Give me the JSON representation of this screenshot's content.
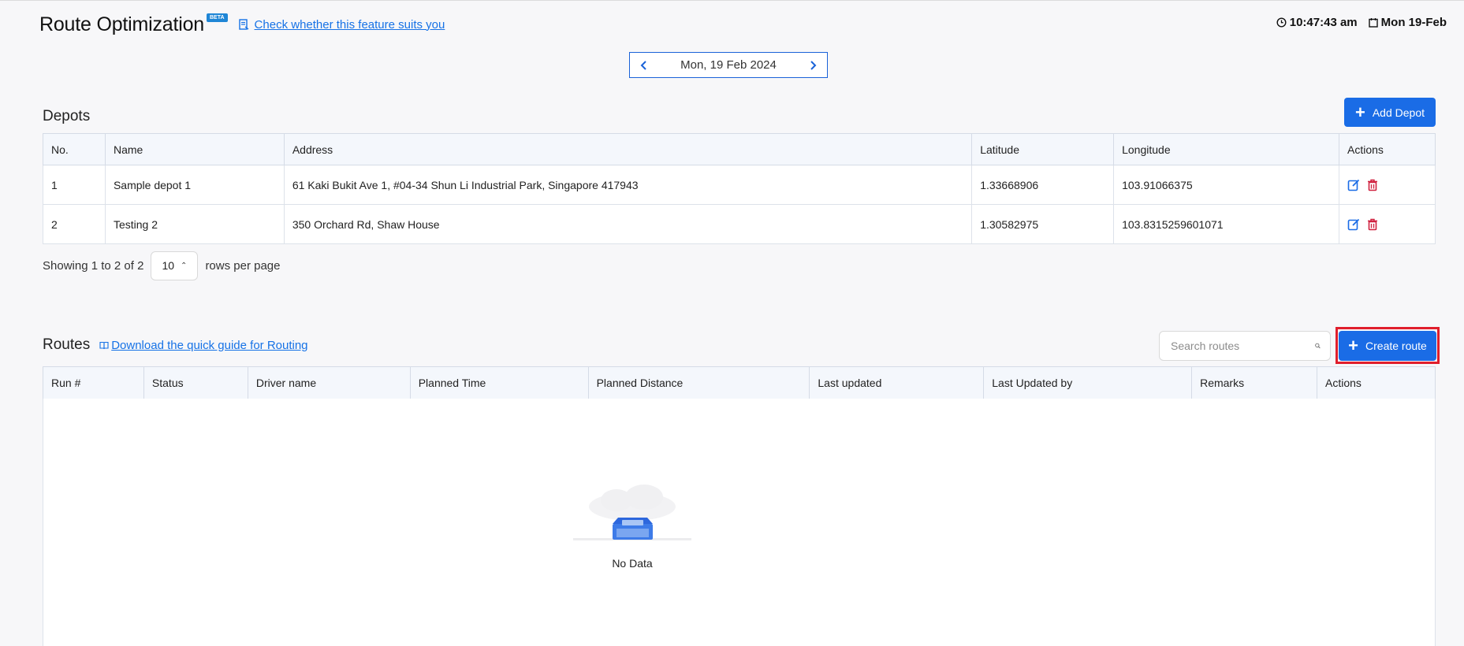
{
  "header": {
    "title": "Route Optimization",
    "beta_badge": "BETA",
    "check_link": "Check whether this feature suits you",
    "time": "10:47:43 am",
    "date": "Mon 19-Feb"
  },
  "date_nav": {
    "date": "Mon, 19 Feb 2024"
  },
  "depots": {
    "title": "Depots",
    "add_button": "Add Depot",
    "columns": [
      "No.",
      "Name",
      "Address",
      "Latitude",
      "Longitude",
      "Actions"
    ],
    "rows": [
      {
        "no": "1",
        "name": "Sample depot 1",
        "address": "61 Kaki Bukit Ave 1, #04-34 Shun Li Industrial Park, Singapore 417943",
        "latitude": "1.33668906",
        "longitude": "103.91066375"
      },
      {
        "no": "2",
        "name": "Testing 2",
        "address": "350 Orchard Rd, Shaw House",
        "latitude": "1.30582975",
        "longitude": "103.8315259601071"
      }
    ],
    "pager": {
      "showing": "Showing 1 to 2 of 2",
      "rows_per_page": "10",
      "rows_label": "rows per page"
    }
  },
  "routes": {
    "title": "Routes",
    "guide_link": "Download the quick guide for Routing",
    "search_placeholder": "Search routes",
    "create_button": "Create route",
    "columns": [
      "Run #",
      "Status",
      "Driver name",
      "Planned Time",
      "Planned Distance",
      "Last updated",
      "Last Updated by",
      "Remarks",
      "Actions"
    ],
    "empty_text": "No Data"
  },
  "colors": {
    "primary": "#1a6ce6",
    "link": "#1672e6",
    "delete": "#d0213f",
    "highlight": "#e01e2c"
  }
}
